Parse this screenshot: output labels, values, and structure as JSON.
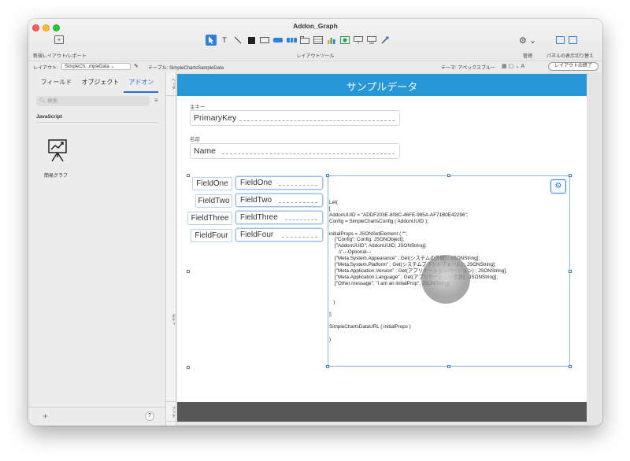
{
  "window": {
    "title": "Addon_Graph"
  },
  "toolbar": {
    "new_layout_label": "新規レイアウト/レポート",
    "layout_tools_label": "レイアウトツール",
    "manage_label": "管理",
    "panels_label": "パネルの表示切り替え"
  },
  "layout_bar": {
    "layout_label": "レイアウト:",
    "layout_value": "SimpleCh...mpleData",
    "table_text": "テーブル: SimpleChartsSampleData",
    "theme_text": "テーマ: アペックスブルー",
    "exit_button": "レイアウトの終了"
  },
  "sidebar": {
    "tabs": [
      {
        "label": "フィールド"
      },
      {
        "label": "オブジェクト"
      },
      {
        "label": "アドオン"
      }
    ],
    "active_tab": "アドオン",
    "search_placeholder": "検索",
    "section_title": "JavaScript",
    "addon_label": "簡易グラフ",
    "help_label": "?"
  },
  "rulers": {
    "header": "ヘッダ",
    "body": "ボディ",
    "footer": "フッタ"
  },
  "layout": {
    "header_title": "サンプルデータ",
    "primary_key_label": "主キー",
    "primary_key_field": "PrimaryKey",
    "name_label": "名前",
    "name_field": "Name",
    "rows": [
      {
        "label": "FieldOne",
        "field": "FieldOne"
      },
      {
        "label": "FieldTwo",
        "field": "FieldTwo"
      },
      {
        "label": "FieldThree",
        "field": "FieldThree"
      },
      {
        "label": "FieldFour",
        "field": "FieldFour"
      }
    ]
  },
  "webviewer": {
    "code": "Let(\n[\nAddonUUID = \"ADDF203E-808C-46FE-985A-AF71B0E42296\";\nConfig = SimpleChartsConfig ( AddonUUID );\n\ninitialProps = JSONSetElement ( \"\";\n    [\"Config\"; Config; JSONObject];\n    [\"AddonUUID\"; AddonUUID; JSONString];\n       // ---Optional---\n    [\"Meta.System.Appearance\" ; Get(システムの外観) ; JSONString];\n    [\"Meta.System.Platform\" ; Get(システムプラットフォーム) ; JSONString];\n    [\"Meta.Application.Version\" ; Get(アプリケーションバージョン) ; JSONString];\n    [\"Meta.Application.Language\" ; Get(アプリケーション言語) ; JSONString];\n    [\"Other.message\"; \"I am an initialProp\"; JSONString]\n\n\n   )\n\n];\n\nSimpleChartsDataURL ( initialProps )\n\n)"
  },
  "colors": {
    "accent": "#2f7fe0",
    "header_band": "#2596d6",
    "footer_band": "#575757"
  }
}
